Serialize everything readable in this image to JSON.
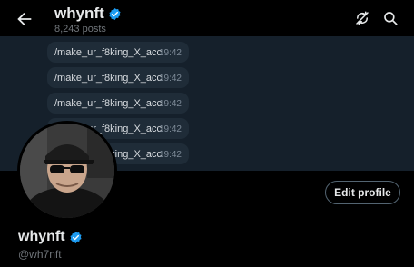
{
  "header": {
    "title": "whynft",
    "post_count": "8,243 posts",
    "icons": [
      "back-arrow-icon",
      "verified-badge-icon",
      "refresh-disabled-icon",
      "search-icon"
    ]
  },
  "banner": {
    "messages": [
      {
        "text": "/make_ur_f8king_X_acc",
        "time": "19:42"
      },
      {
        "text": "/make_ur_f8king_X_acc",
        "time": "19:42"
      },
      {
        "text": "/make_ur_f8king_X_acc",
        "time": "19:42"
      },
      {
        "text": "/make_ur_f8king_X_acc",
        "time": "19:42"
      },
      {
        "text": "/make_ur_f8king_X_acc",
        "time": "19:42"
      }
    ]
  },
  "profile": {
    "name": "whynft",
    "handle": "@wh7nft",
    "edit_button": "Edit profile"
  },
  "colors": {
    "background": "#000000",
    "banner": "#15202b",
    "bubble": "#1f2c38",
    "verified": "#1d9bf0",
    "secondary_text": "#71767b"
  }
}
